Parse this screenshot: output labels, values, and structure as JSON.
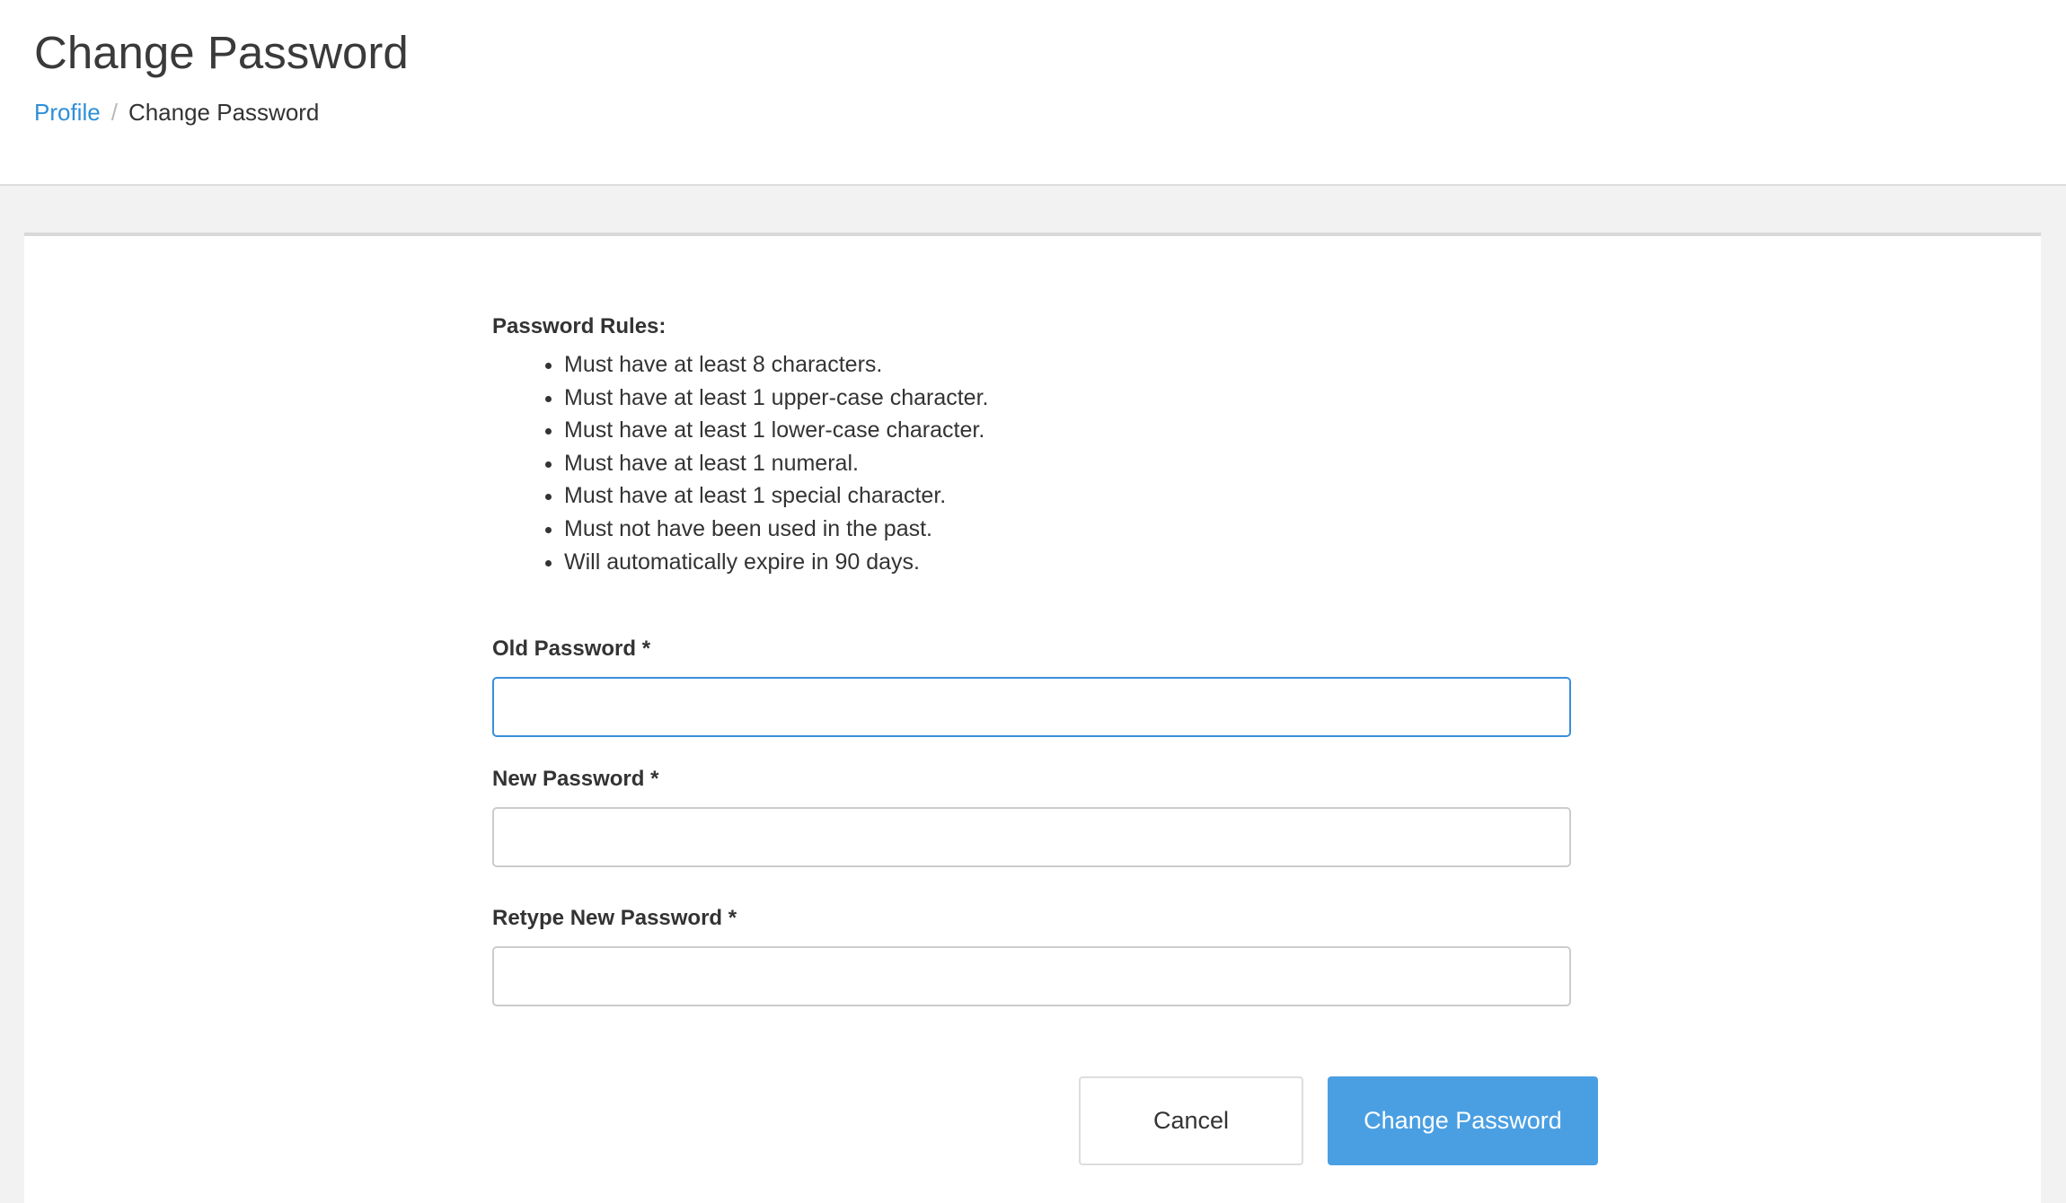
{
  "header": {
    "title": "Change Password",
    "breadcrumb": {
      "link_label": "Profile",
      "separator": "/",
      "current_label": "Change Password"
    }
  },
  "rules": {
    "heading": "Password Rules:",
    "items": [
      "Must have at least 8 characters.",
      "Must have at least 1 upper-case character.",
      "Must have at least 1 lower-case character.",
      "Must have at least 1 numeral.",
      "Must have at least 1 special character.",
      "Must not have been used in the past.",
      "Will automatically expire in 90 days."
    ]
  },
  "form": {
    "old_password": {
      "label": "Old Password *",
      "value": "",
      "focused": true
    },
    "new_password": {
      "label": "New Password *",
      "value": ""
    },
    "retype_password": {
      "label": "Retype New Password *",
      "value": ""
    }
  },
  "actions": {
    "cancel_label": "Cancel",
    "submit_label": "Change Password"
  },
  "colors": {
    "link": "#2e8fd8",
    "primary_button": "#4a9fe3",
    "focus_border": "#3a8fd9",
    "page_background": "#f2f2f2"
  }
}
